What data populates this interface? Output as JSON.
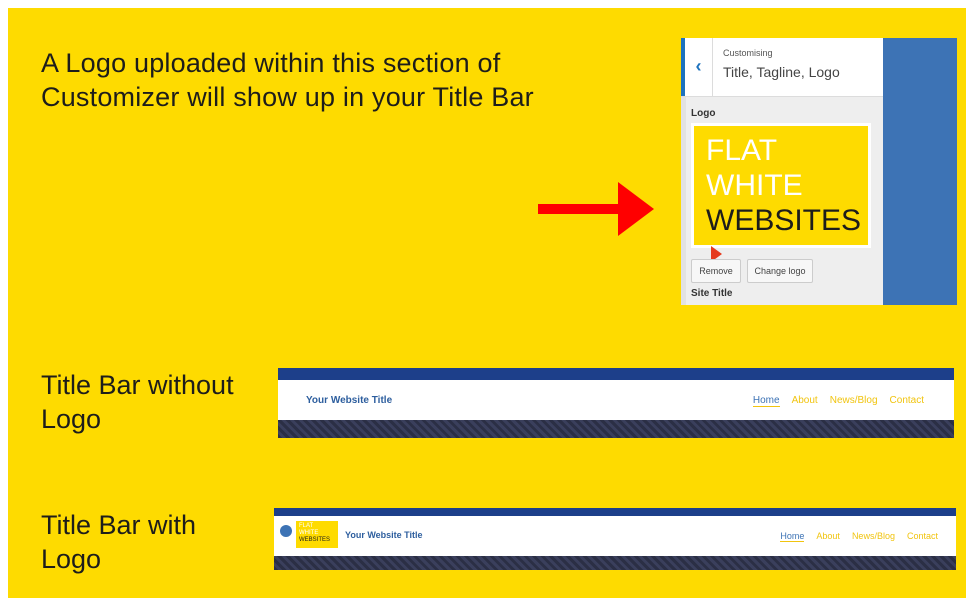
{
  "intro": {
    "line1": "A Logo uploaded within this section of",
    "line2": "Customizer will show up in your Title Bar"
  },
  "customizer": {
    "header_small": "Customising",
    "header_title": "Title, Tagline, Logo",
    "back_label": "‹",
    "logo_section_label": "Logo",
    "logo_lines": [
      "FLAT",
      "WHITE",
      "WEBSITES"
    ],
    "remove_button": "Remove",
    "change_button": "Change logo",
    "site_title_label": "Site Title"
  },
  "without_logo": {
    "label_line1": "Title Bar without",
    "label_line2": "Logo",
    "site_title": "Your Website Title",
    "nav": [
      "Home",
      "About",
      "News/Blog",
      "Contact"
    ]
  },
  "with_logo": {
    "label_line1": "Title Bar with",
    "label_line2": "Logo",
    "site_title": "Your Website Title",
    "mini_logo_lines": [
      "FLAT",
      "WHITE",
      "WEBSITES"
    ],
    "nav": [
      "Home",
      "About",
      "News/Blog",
      "Contact"
    ]
  },
  "colors": {
    "background": "#fedb00",
    "arrow": "#ff0000",
    "brand_blue": "#1d3f8a",
    "link_yellow": "#f1c40f"
  }
}
